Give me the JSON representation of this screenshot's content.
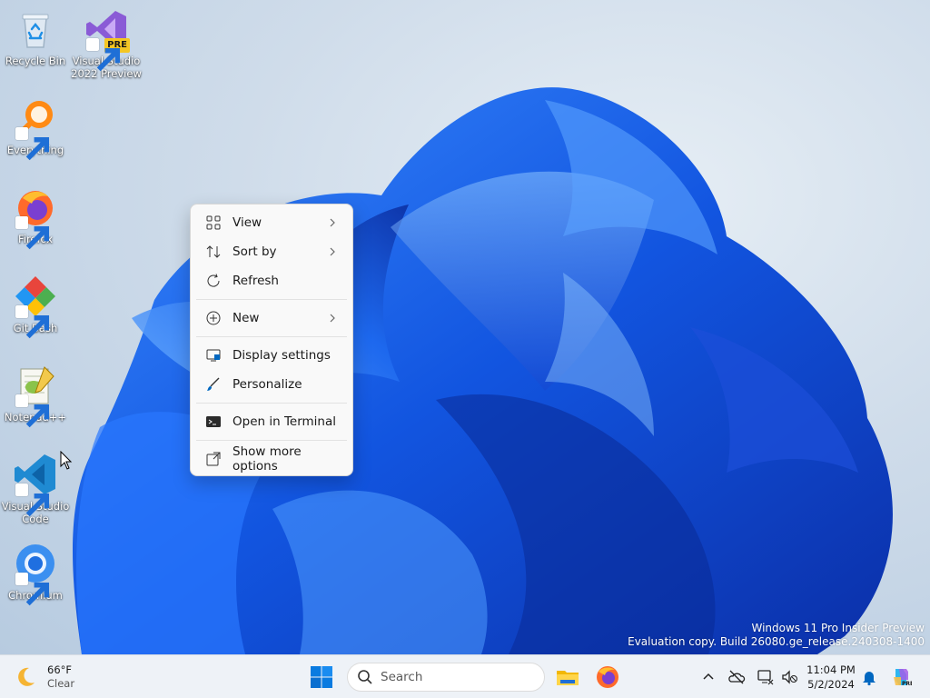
{
  "desktop": {
    "icons": [
      {
        "label": "Recycle Bin",
        "icon": "recycle-bin-icon"
      },
      {
        "label": "Visual Studio 2022 Preview",
        "icon": "visual-studio-icon",
        "badge": "PRE"
      },
      {
        "label": "Everything",
        "icon": "everything-search-icon"
      },
      {
        "label": "Firefox",
        "icon": "firefox-icon"
      },
      {
        "label": "Git Bash",
        "icon": "git-bash-icon"
      },
      {
        "label": "Notepad++",
        "icon": "notepad-plus-plus-icon"
      },
      {
        "label": "Visual Studio Code",
        "icon": "vscode-icon"
      },
      {
        "label": "Chromium",
        "icon": "chromium-icon"
      }
    ]
  },
  "context_menu": {
    "items": [
      {
        "label": "View",
        "icon": "grid-view-icon",
        "submenu": true
      },
      {
        "label": "Sort by",
        "icon": "sort-icon",
        "submenu": true
      },
      {
        "label": "Refresh",
        "icon": "refresh-icon",
        "submenu": false
      },
      {
        "label": "New",
        "icon": "plus-circle-icon",
        "submenu": true
      },
      {
        "label": "Display settings",
        "icon": "display-icon",
        "submenu": false
      },
      {
        "label": "Personalize",
        "icon": "brush-icon",
        "submenu": false
      },
      {
        "label": "Open in Terminal",
        "icon": "terminal-icon",
        "submenu": false
      },
      {
        "label": "Show more options",
        "icon": "external-icon",
        "submenu": false
      }
    ]
  },
  "watermark": {
    "line1": "Windows 11 Pro Insider Preview",
    "line2": "Evaluation copy. Build 26080.ge_release.240308-1400"
  },
  "taskbar": {
    "weather": {
      "temp": "66°F",
      "condition": "Clear",
      "icon": "moon-icon"
    },
    "search": {
      "placeholder": "Search"
    },
    "apps": [
      "windows-start-icon",
      "file-explorer-icon",
      "firefox-icon"
    ],
    "tray": [
      "chevron-up-icon",
      "onedrive-offline-icon",
      "network-icon",
      "volume-muted-icon",
      "notification-bell-icon",
      "copilot-icon"
    ],
    "clock": {
      "time": "11:04 PM",
      "date": "5/2/2024"
    }
  },
  "colors": {
    "accent": "#0067c0",
    "wallpaper_blue": "#1a5fe0",
    "menu_bg": "#f9f9f9"
  }
}
